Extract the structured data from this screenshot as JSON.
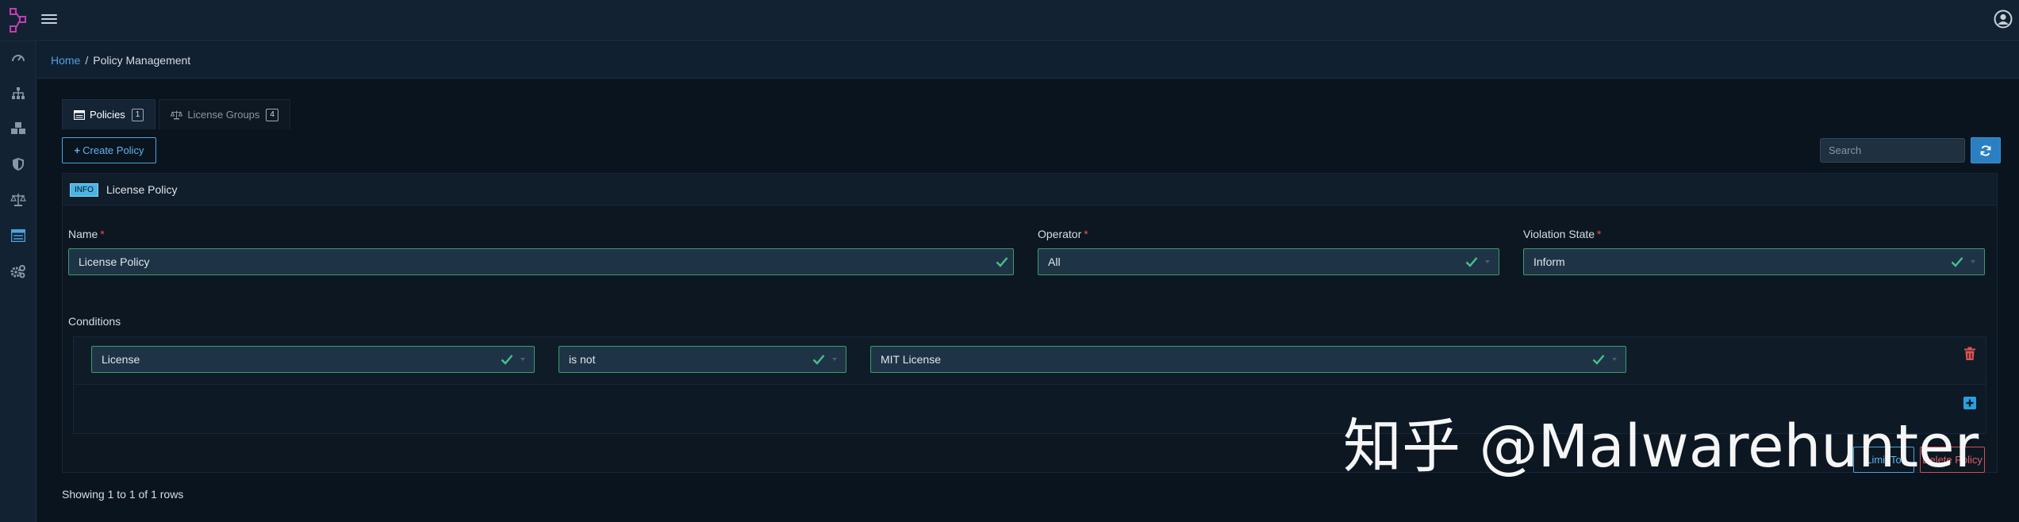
{
  "breadcrumb": {
    "home": "Home",
    "separator": "/",
    "current": "Policy Management"
  },
  "tabs": [
    {
      "label": "Policies",
      "count": "1"
    },
    {
      "label": "License Groups",
      "count": "4"
    }
  ],
  "toolbar": {
    "create_label": "Create Policy",
    "search_placeholder": "Search"
  },
  "policy": {
    "badge": "INFO",
    "title": "License Policy",
    "name_label": "Name",
    "name_value": "License Policy",
    "operator_label": "Operator",
    "operator_value": "All",
    "violation_label": "Violation State",
    "violation_value": "Inform",
    "required_mark": "*",
    "conditions_label": "Conditions",
    "conditions": [
      {
        "subject": "License",
        "operator": "is not",
        "value": "MIT License"
      }
    ],
    "limit_label": "Limit To",
    "delete_label": "Delete Policy"
  },
  "footer": {
    "showing": "Showing 1 to 1 of 1 rows"
  },
  "watermark": "知乎 @Malwarehunter",
  "colors": {
    "accent": "#4da3e0",
    "valid": "#3d9b6a",
    "danger": "#e05555",
    "logo": "#c03fb0"
  }
}
